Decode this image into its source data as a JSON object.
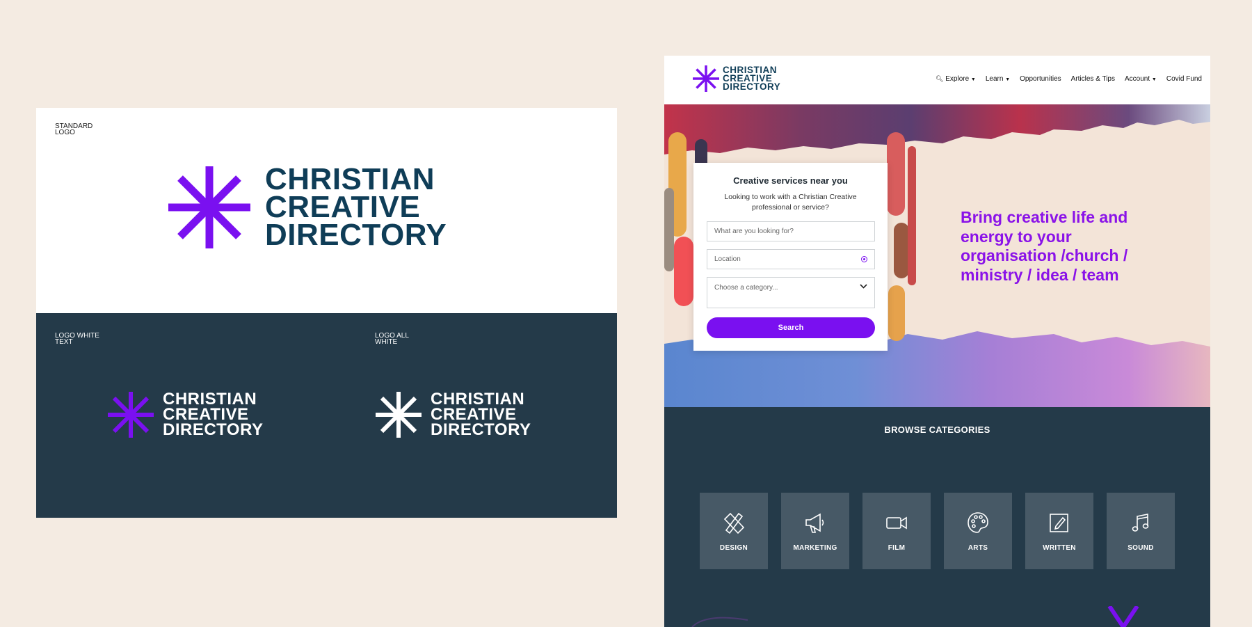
{
  "colors": {
    "background": "#f4ebe2",
    "navy": "#243a49",
    "purple": "#7a10f0",
    "wordmark_blue": "#0f3d57",
    "white": "#ffffff"
  },
  "brand": {
    "name_lines": [
      "CHRISTIAN",
      "CREATIVE",
      "DIRECTORY"
    ]
  },
  "board": {
    "standard_label": "STANDARD\nLOGO",
    "white_text_label": "LOGO WHITE\nTEXT",
    "all_white_label": "LOGO ALL\nWHITE"
  },
  "site": {
    "nav": [
      {
        "label": "Explore",
        "icon": "search-icon",
        "dropdown": true
      },
      {
        "label": "Learn",
        "dropdown": true
      },
      {
        "label": "Opportunities",
        "dropdown": false
      },
      {
        "label": "Articles & Tips",
        "dropdown": false
      },
      {
        "label": "Account",
        "dropdown": true
      },
      {
        "label": "Covid Fund",
        "dropdown": false
      }
    ],
    "search_card": {
      "title": "Creative services near you",
      "subtitle": "Looking to work with a Christian Creative professional or service?",
      "query_placeholder": "What are you looking for?",
      "location_placeholder": "Location",
      "category_placeholder": "Choose a category...",
      "button_label": "Search"
    },
    "tagline": "Bring creative life and energy to your organisation /church / ministry / idea / team",
    "browse_title": "BROWSE CATEGORIES",
    "categories": [
      {
        "label": "DESIGN",
        "icon": "design-pencil-ruler-icon"
      },
      {
        "label": "MARKETING",
        "icon": "megaphone-icon"
      },
      {
        "label": "FILM",
        "icon": "video-camera-icon"
      },
      {
        "label": "ARTS",
        "icon": "palette-icon"
      },
      {
        "label": "WRITTEN",
        "icon": "notepad-pen-icon"
      },
      {
        "label": "SOUND",
        "icon": "music-note-icon"
      }
    ]
  }
}
